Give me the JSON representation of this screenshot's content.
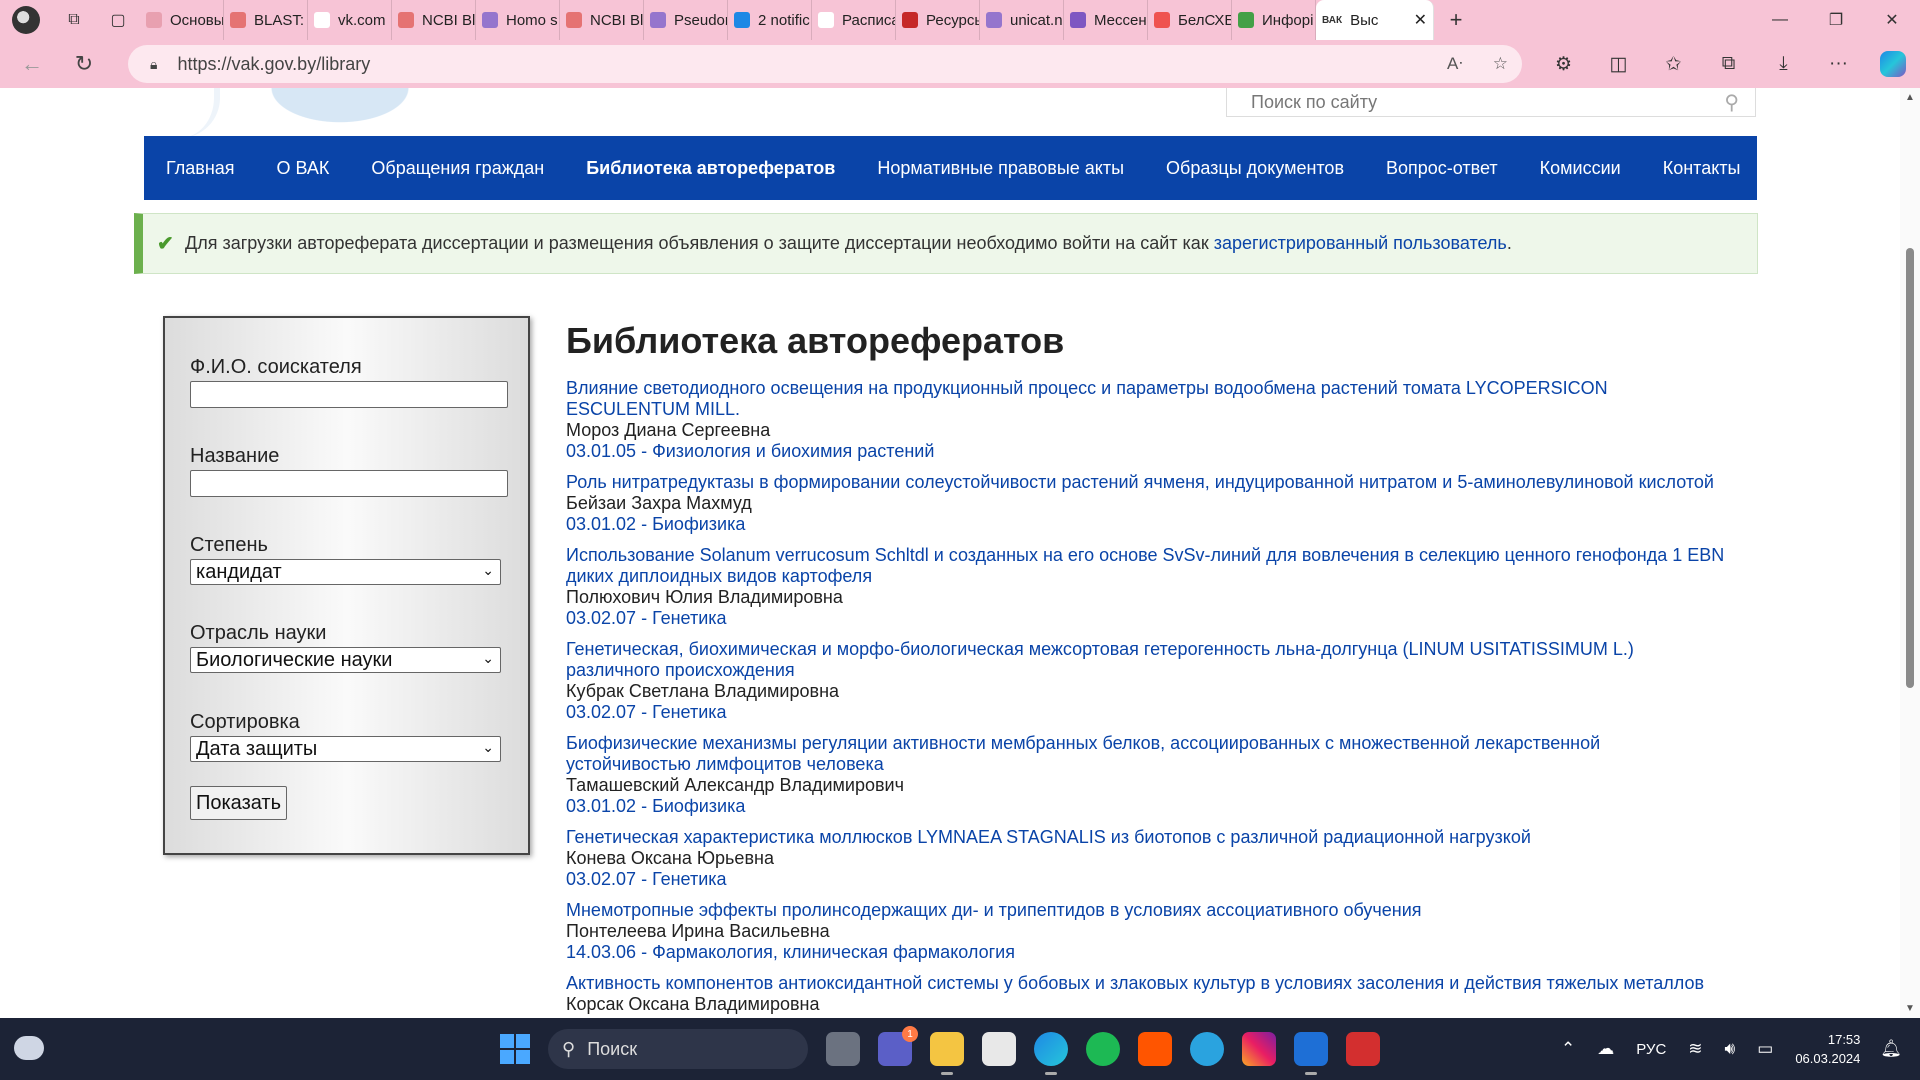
{
  "browser": {
    "tabs": [
      {
        "label": "Основы",
        "color": "#e8a0b0"
      },
      {
        "label": "BLAST: B",
        "color": "#e57373"
      },
      {
        "label": "vk.com",
        "color": "#ffffff"
      },
      {
        "label": "NCBI Bl",
        "color": "#e57373"
      },
      {
        "label": "Homo s",
        "color": "#9575cd"
      },
      {
        "label": "NCBI Bl",
        "color": "#e57373"
      },
      {
        "label": "Pseudor",
        "color": "#9575cd"
      },
      {
        "label": "2 notific",
        "color": "#1e88e5"
      },
      {
        "label": "Расписа",
        "color": "#ffffff"
      },
      {
        "label": "Ресурсы",
        "color": "#c62828"
      },
      {
        "label": "unicat.n",
        "color": "#9575cd"
      },
      {
        "label": "Мессен",
        "color": "#7e57c2"
      },
      {
        "label": "БелСХБ",
        "color": "#ef5350"
      },
      {
        "label": "Инфорі",
        "color": "#43a047"
      }
    ],
    "active_tab": {
      "label": "Выс",
      "favicon_text": "ВАК"
    },
    "url": "https://vak.gov.by/library"
  },
  "site": {
    "search_placeholder": "Поиск по сайту",
    "menu": [
      "Главная",
      "О ВАК",
      "Обращения граждан",
      "Библиотека авторефератов",
      "Нормативные правовые акты",
      "Образцы документов",
      "Вопрос-ответ",
      "Комиссии",
      "Контакты"
    ],
    "alert": {
      "text": "Для загрузки автореферата диссертации и размещения объявления о защите диссертации необходимо войти на сайт как",
      "link": "зарегистрированный пользователь",
      "suffix": "."
    },
    "filter": {
      "fio_label": "Ф.И.О. соискателя",
      "fio_value": "",
      "title_label": "Название",
      "title_value": "",
      "degree_label": "Степень",
      "degree_value": "кандидат",
      "field_label": "Отрасль науки",
      "field_value": "Биологические науки",
      "sort_label": "Сортировка",
      "sort_value": "Дата защиты",
      "submit": "Показать"
    },
    "page_title": "Библиотека авторефератов",
    "items": [
      {
        "title": "Влияние светодиодного освещения на продукционный процесс и параметры водообмена растений томата LYCOPERSICON ESCULENTUM MILL.",
        "author": "Мороз Диана Сергеевна",
        "spec": "03.01.05 - Физиология и биохимия растений"
      },
      {
        "title": "Роль нитратредуктазы в формировании солеустойчивости растений ячменя, индуцированной нитратом и 5-аминолевулиновой кислотой",
        "author": "Бейзаи Захра Махмуд",
        "spec": "03.01.02 - Биофизика"
      },
      {
        "title": "Использование Solanum verrucosum Schltdl и созданных на его основе SvSv-линий для вовлечения в селекцию ценного генофонда 1 EBN диких диплоидных видов картофеля",
        "author": "Полюхович Юлия Владимировна",
        "spec": "03.02.07 - Генетика"
      },
      {
        "title": "Генетическая, биохимическая и морфо-биологическая межсортовая гетерогенность льна-долгунца (LINUM USITATISSIMUM L.) различного происхождения",
        "author": "Кубрак Светлана Владимировна",
        "spec": "03.02.07 - Генетика"
      },
      {
        "title": "Биофизические механизмы регуляции активности мембранных белков, ассоциированных с множественной лекарственной устойчивостью лимфоцитов человека",
        "author": "Тамашевский Александр Владимирович",
        "spec": "03.01.02 - Биофизика"
      },
      {
        "title": "Генетическая характеристика моллюсков LYMNAEA STAGNALIS из биотопов с различной радиационной нагрузкой",
        "author": "Конева Оксана Юрьевна",
        "spec": "03.02.07 - Генетика"
      },
      {
        "title": "Мнемотропные эффекты пролинсодержащих ди- и трипептидов в условиях ассоциативного обучения",
        "author": "Понтелеева Ирина Васильевна",
        "spec": "14.03.06 - Фармакология, клиническая фармакология"
      },
      {
        "title": "Активность компонентов антиоксидантной системы у бобовых и злаковых культур в условиях засоления и действия тяжелых металлов",
        "author": "Корсак Оксана Владимировна",
        "spec": ""
      }
    ]
  },
  "taskbar": {
    "search_label": "Поиск",
    "teams_badge": "1",
    "language": "РУС",
    "time": "17:53",
    "date": "06.03.2024"
  }
}
